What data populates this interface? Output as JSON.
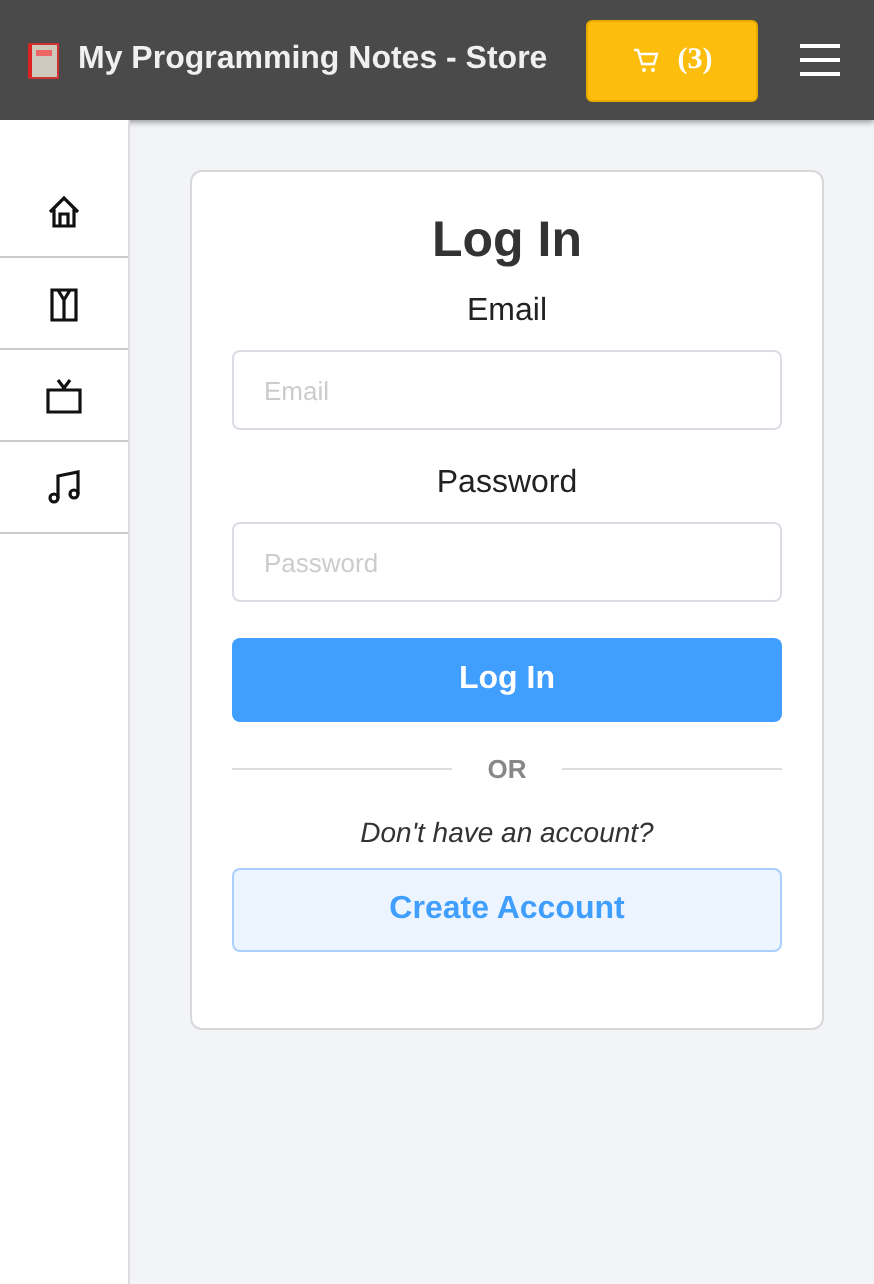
{
  "header": {
    "title": "My Programming Notes - Store",
    "cart_count": "(3)"
  },
  "sidebar": {
    "items": [
      {
        "kind": "home"
      },
      {
        "kind": "shirt"
      },
      {
        "kind": "tv"
      },
      {
        "kind": "music"
      }
    ]
  },
  "login": {
    "title": "Log In",
    "fields": [
      {
        "label": "Email",
        "placeholder": "Email"
      },
      {
        "label": "Password",
        "placeholder": "Password"
      }
    ],
    "submit": "Log In",
    "divider": "OR",
    "prompt": "Don't have an account?",
    "create": "Create Account"
  }
}
